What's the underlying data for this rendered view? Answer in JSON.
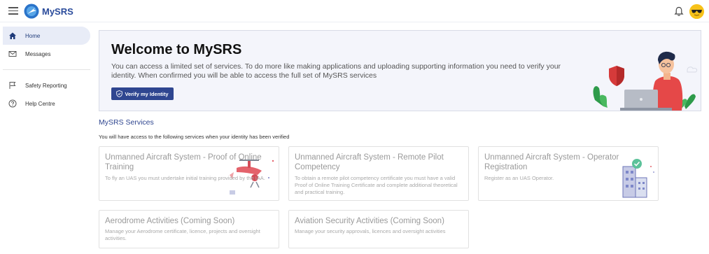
{
  "header": {
    "app_name": "MySRS"
  },
  "sidebar": {
    "items": [
      {
        "label": "Home",
        "icon": "home-icon",
        "active": true
      },
      {
        "label": "Messages",
        "icon": "mail-icon"
      },
      {
        "label": "Safety Reporting",
        "icon": "flag-icon"
      },
      {
        "label": "Help Centre",
        "icon": "help-icon"
      }
    ]
  },
  "welcome": {
    "title": "Welcome to MySRS",
    "body": "You can access a limited set of services. To do more like making applications and uploading supporting information you need to verify your identity. When confirmed you will be able to access the full set of MySRS services",
    "verify_label": "Verify my Identity"
  },
  "services": {
    "title": "MySRS Services",
    "subtitle": "You will have access to the following services when your identity has been verified",
    "cards": [
      {
        "title": "Unmanned Aircraft System - Proof of Online Training",
        "desc": "To fly an UAS you must undertake initial training provided by the IAA."
      },
      {
        "title": "Unmanned Aircraft System - Remote Pilot Competency",
        "desc": "To obtain a remote pilot competency certificate you must have a valid Proof of Online Training Certificate and complete additional theoretical and practical training."
      },
      {
        "title": "Unmanned Aircraft System - Operator Registration",
        "desc": "Register as an UAS Operator."
      },
      {
        "title": "Aerodrome Activities (Coming Soon)",
        "desc": "Manage your Aerodrome certificate, licence, projects and oversight activities."
      },
      {
        "title": "Aviation Security Activities (Coming Soon)",
        "desc": "Manage your security approvals, licences and oversight activities"
      }
    ]
  },
  "colors": {
    "brand": "#2f4690",
    "active_nav_bg": "#e8ecf7",
    "welcome_bg": "#f4f5fb"
  }
}
